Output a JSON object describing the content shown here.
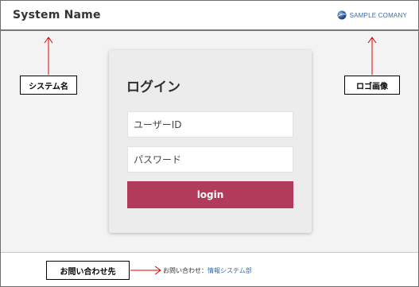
{
  "header": {
    "system_name": "System Name",
    "logo_text": "SAMPLE COMANY",
    "logo_icon": "globe-icon"
  },
  "login_card": {
    "title": "ログイン",
    "user_id_placeholder": "ユーザーID",
    "password_placeholder": "パスワード",
    "login_button": "login"
  },
  "footer": {
    "contact_label": "お問い合わせ：",
    "contact_link": "情報システム部"
  },
  "annotations": {
    "system_name": "システム名",
    "logo_image": "ロゴ画像",
    "contact": "お問い合わせ先"
  },
  "colors": {
    "accent": "#b23a5a",
    "annotation_arrow": "#e00000",
    "link": "#2a6ebb"
  }
}
